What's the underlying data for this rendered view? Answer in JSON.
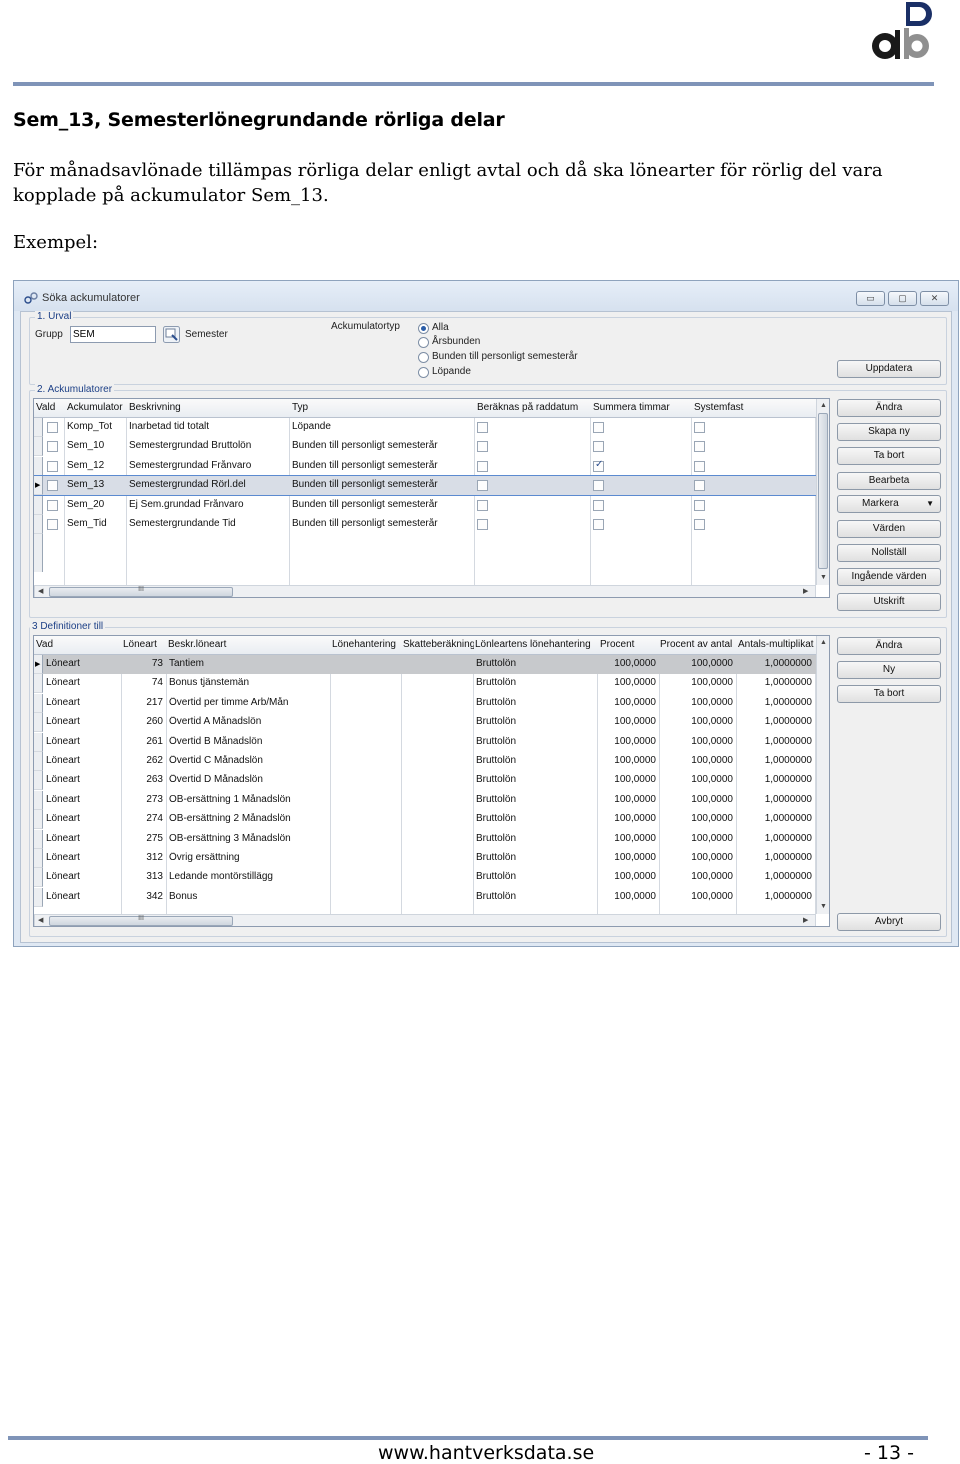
{
  "document": {
    "heading": "Sem_13, Semesterlönegrundande rörliga delar",
    "paragraph": "För månadsavlönade tillämpas rörliga delar enligt avtal och då ska lönearter för rörlig del vara kopplade på ackumulator Sem_13.",
    "example_label": "Exempel:",
    "footer_url": "www.hantverksdata.se",
    "footer_page": "- 13 -",
    "accent_color": "#7f94b8"
  },
  "window": {
    "title": "Söka ackumulatorer",
    "controls": {
      "minimize": "▭",
      "maximize": "▢",
      "close": "✕"
    },
    "urval": {
      "title": "1. Urval",
      "grupp_label": "Grupp",
      "grupp_value": "SEM",
      "semester_label": "Semester",
      "typ_label": "Ackumulatortyp",
      "options": [
        "Alla",
        "Årsbunden",
        "Bunden till personligt semesterår",
        "Löpande"
      ],
      "selected": 0,
      "update_button": "Uppdatera"
    },
    "ack": {
      "title": "2. Ackumulatorer",
      "headers": [
        "Vald",
        "Ackumulator",
        "Beskrivning",
        "Typ",
        "Beräknas på raddatum",
        "Summera timmar",
        "Systemfast"
      ],
      "rows": [
        {
          "ack": "Komp_Tot",
          "desc": "Inarbetad tid totalt",
          "typ": "Löpande",
          "summera": false
        },
        {
          "ack": "Sem_10",
          "desc": "Semestergrundad Bruttolön",
          "typ": "Bunden till personligt semesterår",
          "summera": false
        },
        {
          "ack": "Sem_12",
          "desc": "Semestergrundad Frånvaro",
          "typ": "Bunden till personligt semesterår",
          "summera": true
        },
        {
          "ack": "Sem_13",
          "desc": "Semestergrundad Rörl.del",
          "typ": "Bunden till personligt semesterår",
          "summera": false
        },
        {
          "ack": "Sem_20",
          "desc": "Ej Sem.grundad Frånvaro",
          "typ": "Bunden till personligt semesterår",
          "summera": false
        },
        {
          "ack": "Sem_Tid",
          "desc": "Semestergrundande Tid",
          "typ": "Bunden till personligt semesterår",
          "summera": false
        }
      ],
      "selected_row": 3,
      "buttons": [
        "Ändra",
        "Skapa ny",
        "Ta bort",
        "Bearbeta",
        "Markera",
        "Värden",
        "Nollställ",
        "Ingående värden",
        "Utskrift"
      ],
      "markera_arrow": "▼"
    },
    "def": {
      "title": "3 Definitioner till",
      "headers": [
        "Vad",
        "Löneart",
        "Beskr.löneart",
        "Lönehantering",
        "Skatteberäkning",
        "Lönleartens lönehantering",
        "Procent",
        "Procent av antal",
        "Antals-multiplikat"
      ],
      "rows": [
        {
          "vad": "Löneart",
          "nr": "73",
          "desc": "Tantiem",
          "lh": "Bruttolön",
          "p": "100,0000",
          "pa": "100,0000",
          "m": "1,0000000"
        },
        {
          "vad": "Löneart",
          "nr": "74",
          "desc": "Bonus tjänstemän",
          "lh": "Bruttolön",
          "p": "100,0000",
          "pa": "100,0000",
          "m": "1,0000000"
        },
        {
          "vad": "Löneart",
          "nr": "217",
          "desc": "Övertid per timme Arb/Mån",
          "lh": "Bruttolön",
          "p": "100,0000",
          "pa": "100,0000",
          "m": "1,0000000"
        },
        {
          "vad": "Löneart",
          "nr": "260",
          "desc": "Övertid A Månadslön",
          "lh": "Bruttolön",
          "p": "100,0000",
          "pa": "100,0000",
          "m": "1,0000000"
        },
        {
          "vad": "Löneart",
          "nr": "261",
          "desc": "Övertid B Månadslön",
          "lh": "Bruttolön",
          "p": "100,0000",
          "pa": "100,0000",
          "m": "1,0000000"
        },
        {
          "vad": "Löneart",
          "nr": "262",
          "desc": "Övertid C Månadslön",
          "lh": "Bruttolön",
          "p": "100,0000",
          "pa": "100,0000",
          "m": "1,0000000"
        },
        {
          "vad": "Löneart",
          "nr": "263",
          "desc": "Övertid D Månadslön",
          "lh": "Bruttolön",
          "p": "100,0000",
          "pa": "100,0000",
          "m": "1,0000000"
        },
        {
          "vad": "Löneart",
          "nr": "273",
          "desc": "OB-ersättning 1 Månadslön",
          "lh": "Bruttolön",
          "p": "100,0000",
          "pa": "100,0000",
          "m": "1,0000000"
        },
        {
          "vad": "Löneart",
          "nr": "274",
          "desc": "OB-ersättning 2 Månadslön",
          "lh": "Bruttolön",
          "p": "100,0000",
          "pa": "100,0000",
          "m": "1,0000000"
        },
        {
          "vad": "Löneart",
          "nr": "275",
          "desc": "OB-ersättning 3 Månadslön",
          "lh": "Bruttolön",
          "p": "100,0000",
          "pa": "100,0000",
          "m": "1,0000000"
        },
        {
          "vad": "Löneart",
          "nr": "312",
          "desc": "Övrig ersättning",
          "lh": "Bruttolön",
          "p": "100,0000",
          "pa": "100,0000",
          "m": "1,0000000"
        },
        {
          "vad": "Löneart",
          "nr": "313",
          "desc": "Ledande montörstillägg",
          "lh": "Bruttolön",
          "p": "100,0000",
          "pa": "100,0000",
          "m": "1,0000000"
        },
        {
          "vad": "Löneart",
          "nr": "342",
          "desc": "Bonus",
          "lh": "Bruttolön",
          "p": "100,0000",
          "pa": "100,0000",
          "m": "1,0000000"
        }
      ],
      "selected_row": 0,
      "buttons": [
        "Ändra",
        "Ny",
        "Ta bort"
      ],
      "cancel_button": "Avbryt"
    },
    "scroll_grip": "III",
    "scroll_left": "◀",
    "scroll_right": "▶",
    "scroll_up": "▲",
    "scroll_down": "▼",
    "row_pointer": "▶",
    "colors": {
      "selected_row": "#c7c9cc",
      "focus_border": "#5b8ad0",
      "group_title": "#1c3f86"
    }
  }
}
